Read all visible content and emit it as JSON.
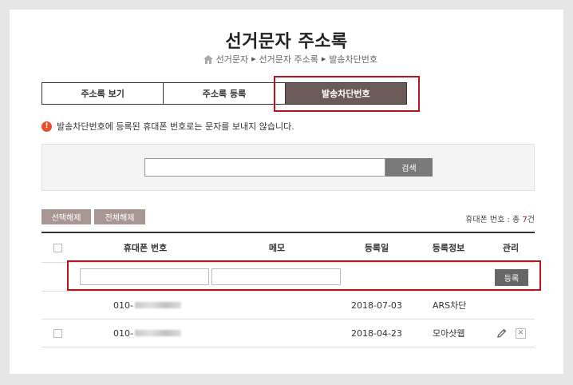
{
  "page": {
    "title": "선거문자 주소록"
  },
  "breadcrumb": {
    "items": [
      "선거문자",
      "선거문자 주소록",
      "발송차단번호"
    ]
  },
  "tabs": [
    {
      "label": "주소록 보기",
      "active": false
    },
    {
      "label": "주소록 등록",
      "active": false
    },
    {
      "label": "발송차단번호",
      "active": true
    }
  ],
  "notice": {
    "icon": "!",
    "text": "발송차단번호에 등록된 휴대폰 번호로는 문자를 보내지 않습니다."
  },
  "search": {
    "value": "",
    "button_label": "검색"
  },
  "actions": {
    "deselect_label": "선택해제",
    "clear_all_label": "전체해제"
  },
  "count": {
    "prefix": "휴대폰 번호 : 총 ",
    "number": "7",
    "suffix": "건"
  },
  "table": {
    "headers": [
      "휴대폰 번호",
      "메모",
      "등록일",
      "등록정보",
      "관리"
    ],
    "register_button": "등록",
    "rows": [
      {
        "phone_prefix": "010-",
        "date": "2018-07-03",
        "info": "ARS차단",
        "has_checkbox": false,
        "has_actions": false
      },
      {
        "phone_prefix": "010-",
        "date": "2018-04-23",
        "info": "모아샷웹",
        "has_checkbox": true,
        "has_actions": true
      }
    ]
  },
  "colors": {
    "accent": "#6b5a57",
    "highlight": "#b8141b",
    "button": "#a89693"
  }
}
